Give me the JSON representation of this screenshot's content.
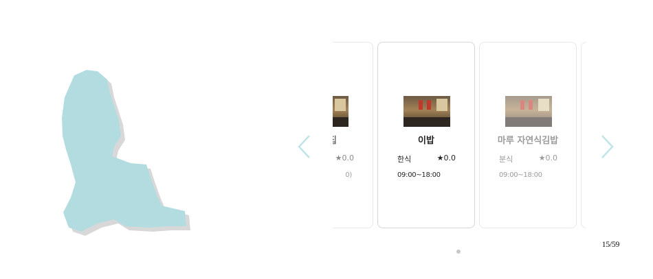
{
  "map": {
    "region_color": "#b3dce1",
    "shadow_color": "#d8d8d8"
  },
  "carousel": {
    "cards": [
      {
        "name": "원빵집",
        "visible_name": "l빵집",
        "category": "",
        "rating": "★0.0",
        "hours": "0)",
        "state": "partial"
      },
      {
        "name": "이밥",
        "category": "한식",
        "rating": "★0.0",
        "hours": "09:00~18:00",
        "state": "active"
      },
      {
        "name": "마루 자연식김밥",
        "category": "분식",
        "rating": "★0.0",
        "hours": "09:00~18:00",
        "state": "dim"
      }
    ],
    "arrow_color": "#bfe4e8"
  },
  "pagination": {
    "counter": "15/59"
  }
}
